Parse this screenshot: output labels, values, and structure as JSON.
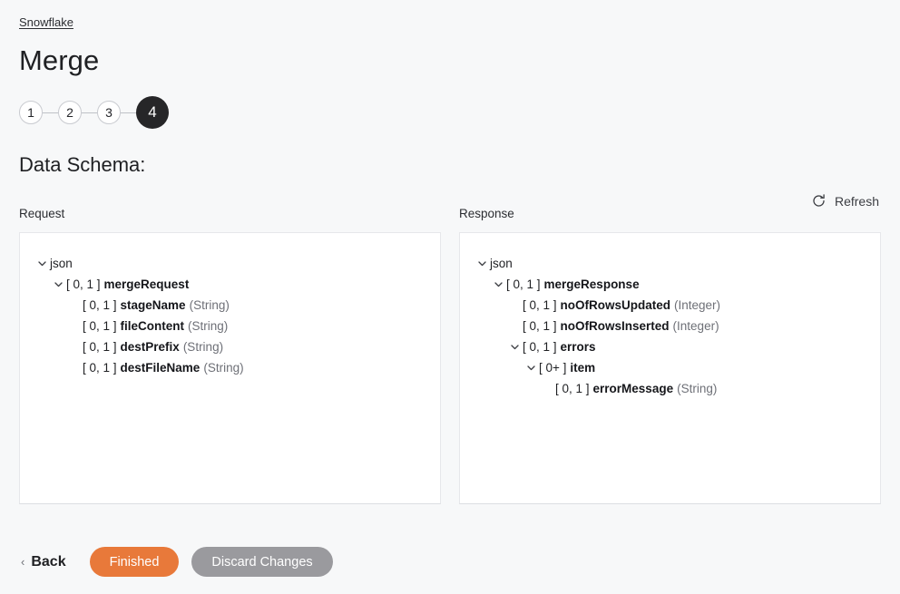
{
  "breadcrumb": {
    "label": "Snowflake"
  },
  "header": {
    "title": "Merge"
  },
  "stepper": {
    "steps": [
      {
        "label": "1",
        "active": false
      },
      {
        "label": "2",
        "active": false
      },
      {
        "label": "3",
        "active": false
      },
      {
        "label": "4",
        "active": true
      }
    ]
  },
  "section": {
    "title": "Data Schema:"
  },
  "toolbar": {
    "refresh_label": "Refresh",
    "refresh_icon": "refresh-icon"
  },
  "request": {
    "label": "Request",
    "tree": [
      {
        "indent": 0,
        "expander": true,
        "cardinality": "",
        "name": "json",
        "bold": false,
        "type": ""
      },
      {
        "indent": 1,
        "expander": true,
        "cardinality": "[ 0, 1 ]",
        "name": "mergeRequest",
        "bold": true,
        "type": ""
      },
      {
        "indent": 2,
        "expander": false,
        "cardinality": "[ 0, 1 ]",
        "name": "stageName",
        "bold": true,
        "type": "(String)"
      },
      {
        "indent": 2,
        "expander": false,
        "cardinality": "[ 0, 1 ]",
        "name": "fileContent",
        "bold": true,
        "type": "(String)"
      },
      {
        "indent": 2,
        "expander": false,
        "cardinality": "[ 0, 1 ]",
        "name": "destPrefix",
        "bold": true,
        "type": "(String)"
      },
      {
        "indent": 2,
        "expander": false,
        "cardinality": "[ 0, 1 ]",
        "name": "destFileName",
        "bold": true,
        "type": "(String)"
      }
    ]
  },
  "response": {
    "label": "Response",
    "tree": [
      {
        "indent": 0,
        "expander": true,
        "cardinality": "",
        "name": "json",
        "bold": false,
        "type": ""
      },
      {
        "indent": 1,
        "expander": true,
        "cardinality": "[ 0, 1 ]",
        "name": "mergeResponse",
        "bold": true,
        "type": ""
      },
      {
        "indent": 2,
        "expander": false,
        "cardinality": "[ 0, 1 ]",
        "name": "noOfRowsUpdated",
        "bold": true,
        "type": "(Integer)"
      },
      {
        "indent": 2,
        "expander": false,
        "cardinality": "[ 0, 1 ]",
        "name": "noOfRowsInserted",
        "bold": true,
        "type": "(Integer)"
      },
      {
        "indent": 2,
        "expander": true,
        "cardinality": "[ 0, 1 ]",
        "name": "errors",
        "bold": true,
        "type": ""
      },
      {
        "indent": 3,
        "expander": true,
        "cardinality": "[ 0+ ]",
        "name": "item",
        "bold": true,
        "type": ""
      },
      {
        "indent": 4,
        "expander": false,
        "cardinality": "[ 0, 1 ]",
        "name": "errorMessage",
        "bold": true,
        "type": "(String)"
      }
    ]
  },
  "footer": {
    "back_label": "Back",
    "back_chevron": "‹",
    "finished_label": "Finished",
    "discard_label": "Discard Changes"
  },
  "colors": {
    "primary": "#e8793a",
    "secondary": "#9a9a9e",
    "active_step": "#262628",
    "page_bg": "#f7f8f9"
  }
}
